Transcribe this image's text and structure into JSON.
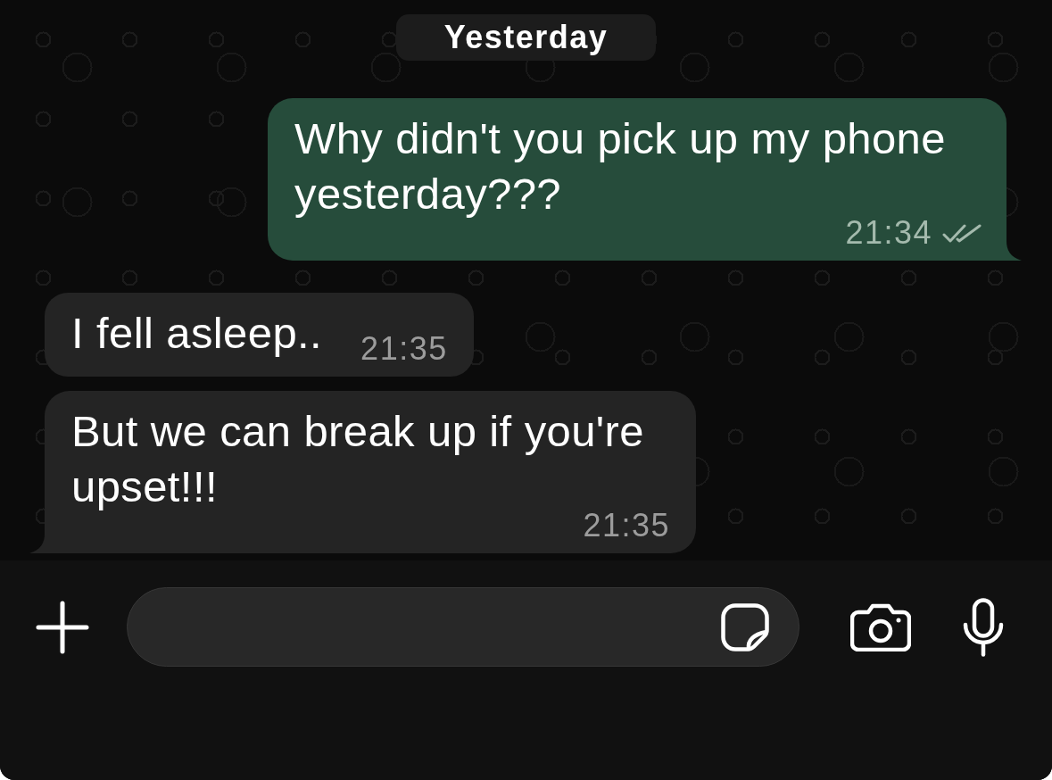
{
  "date_separator": "Yesterday",
  "messages": [
    {
      "kind": "sent",
      "text": "Why didn't you pick up my phone yesterday???",
      "time": "21:34",
      "read": false,
      "tail": true
    },
    {
      "kind": "received",
      "text": "I fell asleep..",
      "time": "21:35",
      "tail": false
    },
    {
      "kind": "received",
      "text": "But we can break up if you're upset!!!",
      "time": "21:35",
      "tail": true
    }
  ]
}
